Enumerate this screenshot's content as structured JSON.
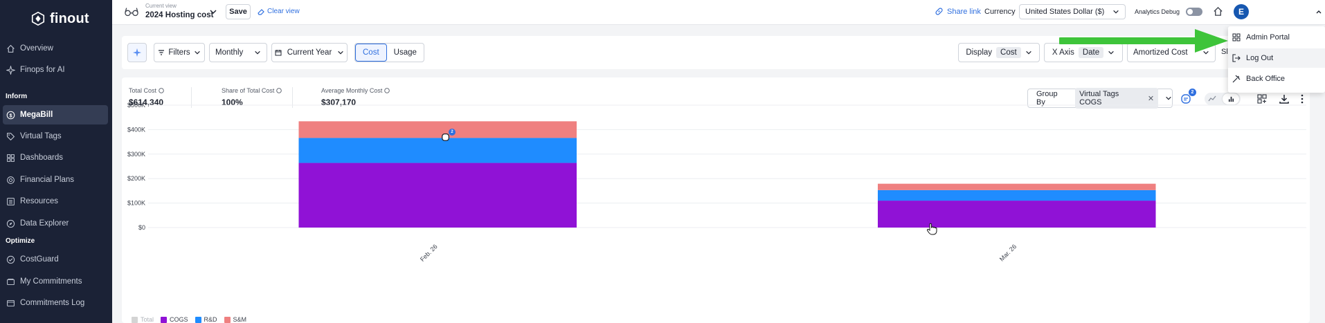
{
  "sidebar": {
    "logo": "finout",
    "items": [
      {
        "label": "Overview",
        "icon": "home-icon"
      },
      {
        "label": "Finops for AI",
        "icon": "sparkle-icon"
      },
      {
        "label": "MegaBill",
        "icon": "dollar-icon",
        "active": true
      },
      {
        "label": "Virtual Tags",
        "icon": "tag-icon"
      },
      {
        "label": "Dashboards",
        "icon": "grid-icon"
      },
      {
        "label": "Financial Plans",
        "icon": "target-icon"
      },
      {
        "label": "Resources",
        "icon": "list-icon"
      },
      {
        "label": "Data Explorer",
        "icon": "compass-icon"
      },
      {
        "label": "CostGuard",
        "icon": "check-circle-icon"
      },
      {
        "label": "My Commitments",
        "icon": "wallet-icon"
      },
      {
        "label": "Commitments Log",
        "icon": "log-icon"
      }
    ],
    "sections": {
      "inform": "Inform",
      "optimize": "Optimize"
    }
  },
  "topbar": {
    "view_caption": "Current view",
    "view_name": "2024 Hosting cost",
    "save_label": "Save",
    "clear_view_label": "Clear view",
    "share_link_label": "Share link",
    "currency_label": "Currency",
    "currency_value": "United States Dollar ($)",
    "analytics_label": "Analytics Debug",
    "avatar_initial": "E"
  },
  "filterbar": {
    "filters_label": "Filters",
    "granularity": "Monthly",
    "date_range": "Current Year",
    "cost_label": "Cost",
    "usage_label": "Usage",
    "display_label": "Display",
    "display_value": "Cost",
    "xaxis_label": "X Axis",
    "xaxis_value": "Date",
    "cost_type": "Amortized Cost",
    "truncated": "Sl"
  },
  "kpis": {
    "total_cost_label": "Total Cost",
    "total_cost_value": "$614,340",
    "share_label": "Share of Total Cost",
    "share_value": "100%",
    "avg_label": "Average Monthly Cost",
    "avg_value": "$307,170"
  },
  "groupby": {
    "label": "Group By",
    "value": "Virtual Tags COGS",
    "comments_badge": "2",
    "chart_comment_badge": "2"
  },
  "menu": {
    "items": [
      {
        "label": "Admin Portal",
        "icon": "admin-icon"
      },
      {
        "label": "Log Out",
        "icon": "logout-icon"
      },
      {
        "label": "Back Office",
        "icon": "tools-icon"
      }
    ]
  },
  "colors": {
    "cogs": "#9012d6",
    "rnd": "#1f8cff",
    "snm": "#ef8080",
    "total": "#d4d4d4",
    "arrow": "#3ec43a"
  },
  "chart_data": {
    "type": "bar",
    "stacked": true,
    "categories": [
      "Feb. 26",
      "Mar. 26"
    ],
    "series": [
      {
        "name": "COGS",
        "values": [
          264000,
          110000
        ]
      },
      {
        "name": "R&D",
        "values": [
          102000,
          43000
        ]
      },
      {
        "name": "S&M",
        "values": [
          68000,
          26000
        ]
      }
    ],
    "legend": [
      "Total",
      "COGS",
      "R&D",
      "S&M"
    ],
    "y_ticks": [
      "$0",
      "$100K",
      "$200K",
      "$300K",
      "$400K",
      "$500K"
    ],
    "ylim": [
      0,
      500000
    ],
    "grid": true,
    "legend_position": "bottom-left"
  }
}
